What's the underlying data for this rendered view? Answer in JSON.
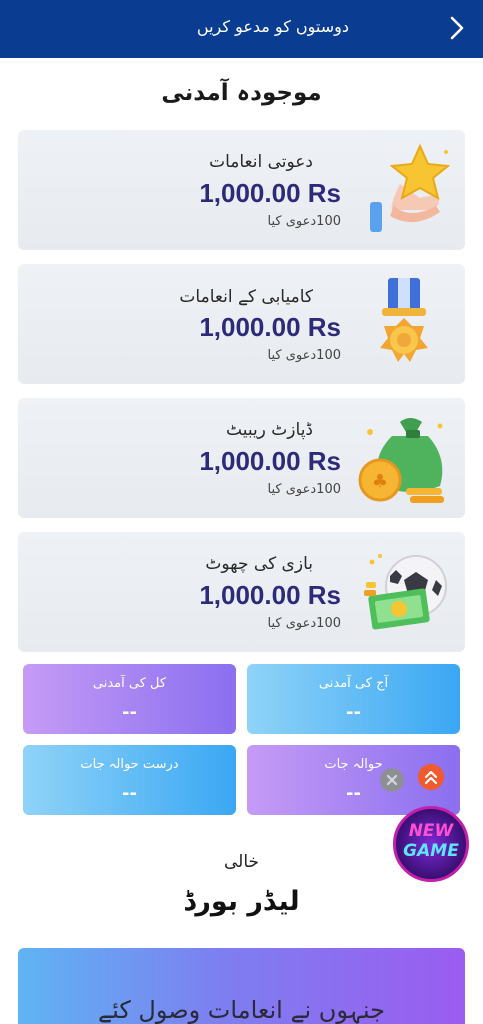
{
  "header": {
    "title": "دوستوں کو مدعو کریں"
  },
  "earnings": {
    "title": "موجودہ آمدنی",
    "cards": [
      {
        "label": "دعوتی انعامات",
        "amount": "1,000.00 Rs",
        "claimed": "100دعوی کیا",
        "icon": "star-hand-icon"
      },
      {
        "label": "کامیابی کے انعامات",
        "amount": "1,000.00 Rs",
        "claimed": "100دعوی کیا",
        "icon": "medal-icon"
      },
      {
        "label": "ڈپازٹ ریبیٹ",
        "amount": "1,000.00 Rs",
        "claimed": "100دعوی کیا",
        "icon": "money-bag-icon"
      },
      {
        "label": "بازی کی چھوٹ",
        "amount": "1,000.00 Rs",
        "claimed": "100دعوی کیا",
        "icon": "soccer-money-icon"
      }
    ]
  },
  "stats": [
    {
      "label": "کل کی آمدنی",
      "value": "--"
    },
    {
      "label": "آج کی آمدنی",
      "value": "--"
    },
    {
      "label": "درست حوالہ جات",
      "value": "--"
    },
    {
      "label": "حوالہ جات",
      "value": "--"
    }
  ],
  "floating": {
    "new_game_line1": "NEW",
    "new_game_line2": "GAME"
  },
  "leaderboard": {
    "empty_text": "خالی",
    "title": "لیڈر بورڈ",
    "banner_text": "جنہوں نے انعامات وصول کئے"
  },
  "colors": {
    "header": "#0a3d91",
    "amount": "#2e2a7a",
    "stat_purple": "#8a6ff0",
    "stat_blue": "#3aa7f3",
    "chevron_button": "#f15a2c"
  }
}
